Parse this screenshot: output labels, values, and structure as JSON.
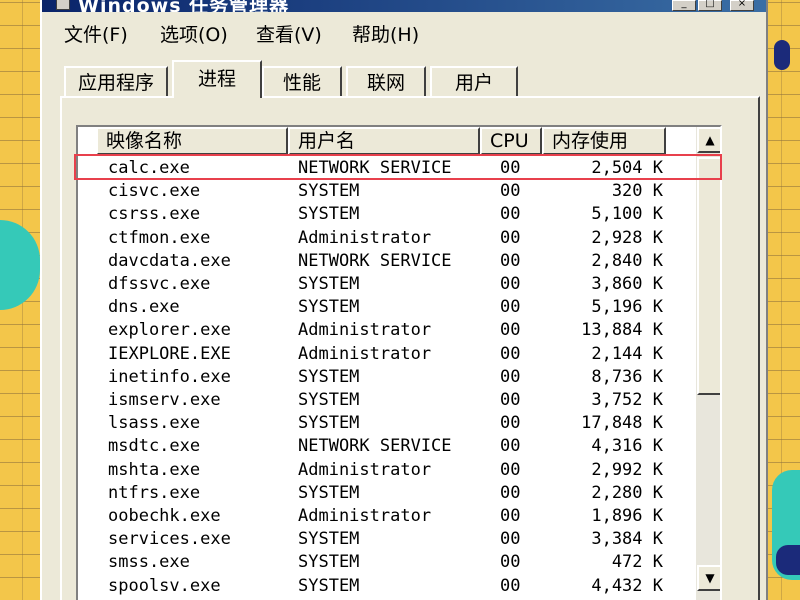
{
  "window": {
    "title": "Windows 任务管理器",
    "buttons": [
      "_",
      "□",
      "×"
    ]
  },
  "menu": [
    "文件(F)",
    "选项(O)",
    "查看(V)",
    "帮助(H)"
  ],
  "tabs": [
    {
      "label": "应用程序",
      "active": false
    },
    {
      "label": "进程",
      "active": true
    },
    {
      "label": "性能",
      "active": false
    },
    {
      "label": "联网",
      "active": false
    },
    {
      "label": "用户",
      "active": false
    }
  ],
  "columns": [
    "映像名称",
    "用户名",
    "CPU",
    "内存使用"
  ],
  "processes": [
    {
      "name": "calc.exe",
      "user": "NETWORK SERVICE",
      "cpu": "00",
      "mem": "2,504 K"
    },
    {
      "name": "cisvc.exe",
      "user": "SYSTEM",
      "cpu": "00",
      "mem": "320 K"
    },
    {
      "name": "csrss.exe",
      "user": "SYSTEM",
      "cpu": "00",
      "mem": "5,100 K"
    },
    {
      "name": "ctfmon.exe",
      "user": "Administrator",
      "cpu": "00",
      "mem": "2,928 K"
    },
    {
      "name": "davcdata.exe",
      "user": "NETWORK SERVICE",
      "cpu": "00",
      "mem": "2,840 K"
    },
    {
      "name": "dfssvc.exe",
      "user": "SYSTEM",
      "cpu": "00",
      "mem": "3,860 K"
    },
    {
      "name": "dns.exe",
      "user": "SYSTEM",
      "cpu": "00",
      "mem": "5,196 K"
    },
    {
      "name": "explorer.exe",
      "user": "Administrator",
      "cpu": "00",
      "mem": "13,884 K"
    },
    {
      "name": "IEXPLORE.EXE",
      "user": "Administrator",
      "cpu": "00",
      "mem": "2,144 K"
    },
    {
      "name": "inetinfo.exe",
      "user": "SYSTEM",
      "cpu": "00",
      "mem": "8,736 K"
    },
    {
      "name": "ismserv.exe",
      "user": "SYSTEM",
      "cpu": "00",
      "mem": "3,752 K"
    },
    {
      "name": "lsass.exe",
      "user": "SYSTEM",
      "cpu": "00",
      "mem": "17,848 K"
    },
    {
      "name": "msdtc.exe",
      "user": "NETWORK SERVICE",
      "cpu": "00",
      "mem": "4,316 K"
    },
    {
      "name": "mshta.exe",
      "user": "Administrator",
      "cpu": "00",
      "mem": "2,992 K"
    },
    {
      "name": "ntfrs.exe",
      "user": "SYSTEM",
      "cpu": "00",
      "mem": "2,280 K"
    },
    {
      "name": "oobechk.exe",
      "user": "Administrator",
      "cpu": "00",
      "mem": "1,896 K"
    },
    {
      "name": "services.exe",
      "user": "SYSTEM",
      "cpu": "00",
      "mem": "3,384 K"
    },
    {
      "name": "smss.exe",
      "user": "SYSTEM",
      "cpu": "00",
      "mem": "472 K"
    },
    {
      "name": "spoolsv.exe",
      "user": "SYSTEM",
      "cpu": "00",
      "mem": "4,432 K"
    }
  ],
  "highlight_color": "#e8404c",
  "icons": {
    "scroll_up": "▲",
    "scroll_down": "▼"
  }
}
